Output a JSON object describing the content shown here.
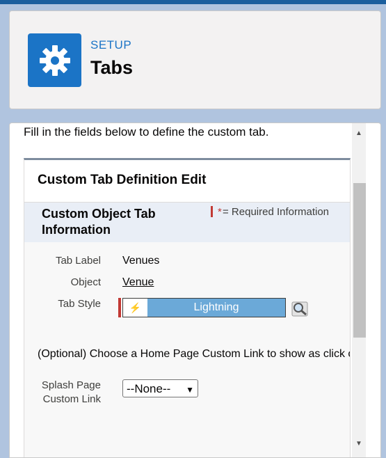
{
  "header": {
    "section_label": "SETUP",
    "title": "Tabs"
  },
  "intro_text": "Fill in the fields below to define the custom tab.",
  "panel": {
    "title": "Custom Tab Definition Edit",
    "section_title": "Custom Object Tab Information",
    "required_star": "*",
    "required_text": "= Required Information"
  },
  "fields": {
    "tab_label": {
      "label": "Tab Label",
      "value": "Venues"
    },
    "object": {
      "label": "Object",
      "value": "Venue"
    },
    "tab_style": {
      "label": "Tab Style",
      "value": "Lightning",
      "icon": "lightning-icon",
      "color": "#6ba9d8"
    }
  },
  "optional_text": "(Optional) Choose a Home Page Custom Link to show as click on this tab.",
  "splash": {
    "label": "Splash Page Custom Link",
    "selected": "--None--"
  },
  "colors": {
    "accent": "#1b74c6",
    "required": "#c23934"
  }
}
